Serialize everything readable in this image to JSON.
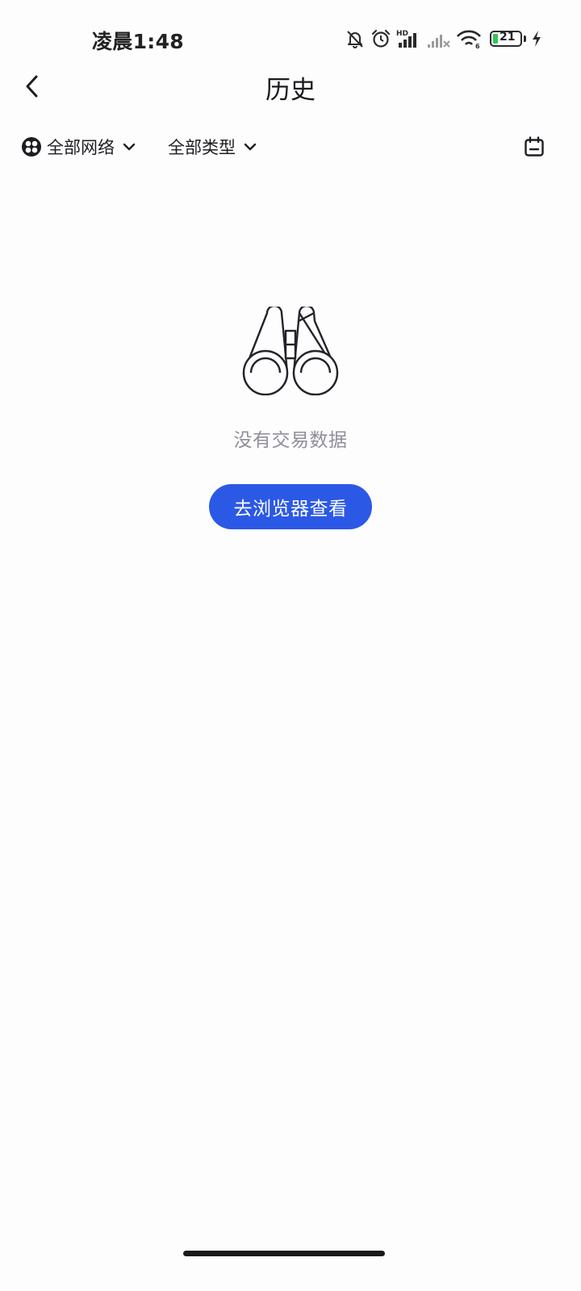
{
  "status_bar": {
    "time": "凌晨1:48",
    "battery_level": "21",
    "network_badge": "HD"
  },
  "header": {
    "title": "历史"
  },
  "filters": {
    "network_label": "全部网络",
    "type_label": "全部类型"
  },
  "empty_state": {
    "message": "没有交易数据",
    "button_label": "去浏览器查看"
  },
  "icons": {
    "back": "chevron-left-icon",
    "network": "grid-dots-icon",
    "dropdown": "chevron-down-icon",
    "calendar": "calendar-icon",
    "empty": "binoculars-icon"
  },
  "colors": {
    "accent": "#2b59e6",
    "muted_text": "#8f8f99",
    "battery": "#34c759"
  }
}
